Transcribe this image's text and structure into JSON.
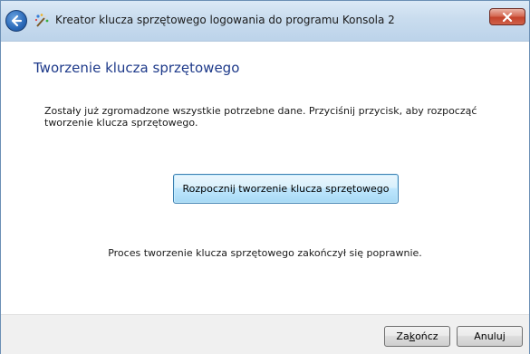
{
  "window": {
    "title": "Kreator klucza sprzętowego logowania do programu Konsola 2"
  },
  "page": {
    "heading": "Tworzenie klucza sprzętowego",
    "description": "Zostały już zgromadzone wszystkie potrzebne dane. Przyciśnij przycisk, aby rozpocząć tworzenie klucza sprzętowego.",
    "start_button_label": "Rozpocznij tworzenie klucza sprzętowego",
    "status_text": "Proces tworzenie klucza sprzętowego zakończył się poprawnie."
  },
  "footer": {
    "finish_label_pre": "Za",
    "finish_label_mnemonic": "k",
    "finish_label_post": "ończ",
    "cancel_label": "Anuluj"
  },
  "colors": {
    "heading": "#1e3a8a",
    "titlebar": "#c9dcee",
    "close_button": "#c4432b"
  },
  "icons": {
    "back": "back-arrow-icon",
    "wizard": "wizard-wand-icon",
    "close": "close-icon"
  }
}
